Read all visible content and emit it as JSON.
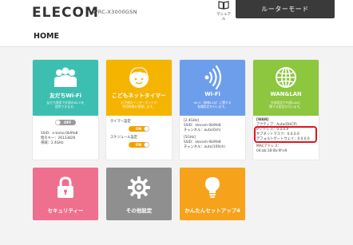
{
  "header": {
    "logo": "ELECOM",
    "model": "WRC-X3000GSN",
    "manual_label": "マニュアル",
    "mode_button": "ルーターモード"
  },
  "page": {
    "title": "HOME"
  },
  "tiles": {
    "friends_wifi": {
      "title": "友だちWi-Fi",
      "desc_1": "友だち専用で外部のWi-Fiを",
      "desc_2": "提供できます。",
      "toggle": "OFF",
      "ssid": "SSID：e-tomo-0b9fe8",
      "password": "暗号キー：26133826",
      "band": "帯域：2.4GHz",
      "color": "#3cbfb0"
    },
    "kids_timer": {
      "title": "こどもネットタイマー",
      "desc_1": "お子様のインターネットの",
      "desc_2": "利用時間を管理します。",
      "timer_label": "タイマー設定",
      "timer_toggle": "ON",
      "schedule_label": "スケジュール設定",
      "schedule_toggle": "ON",
      "color": "#f4b400"
    },
    "wifi": {
      "title": "Wi-Fi",
      "desc_1": "Wi-Fi（無線LAN）に関する",
      "desc_2": "各種設定を行います。",
      "band24": "[2.4GHz]",
      "ssid24": "SSID：elecom-0b9fe8",
      "ch24": "チャンネル：auto(0ch)",
      "band5": "[5GHz]",
      "ssid5": "SSID：elecom-0b9fe8",
      "ch5": "チャンネル：auto(100ch)",
      "color": "#6d9eeb"
    },
    "wanlan": {
      "title": "WAN&LAN",
      "desc_1": "外部設定や内部LANに",
      "desc_2": "関する設定を行います。",
      "heading": "[WAN]",
      "line1": "アクティブ：Auto(DHCP)",
      "line2": "IPアドレス：0.0.0.0",
      "line3": "サブネットマスク：0.0.0.0",
      "line4": "デフォルトゲートウェイ：0.0.0.0",
      "line5": "MACアドレス：",
      "line6": "04:ab:18:0b:9f:e9",
      "color": "#8dc63f"
    },
    "security": {
      "label": "セキュリティー",
      "color": "#ef6f8f"
    },
    "other": {
      "label": "その他設定",
      "color": "#8f8f8f"
    },
    "setup": {
      "label": "かんたんセットアップ4",
      "color": "#f7a21b"
    }
  }
}
